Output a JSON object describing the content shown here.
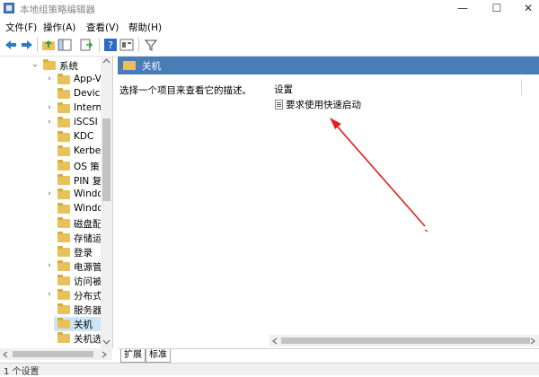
{
  "window": {
    "title": "本地组策略编辑器",
    "minimize": "—",
    "maximize": "☐",
    "close": "✕"
  },
  "menu": [
    "文件(F)",
    "操作(A)",
    "查看(V)",
    "帮助(H)"
  ],
  "tree": [
    {
      "label": "系统",
      "expander": "⌄",
      "indent": 1
    },
    {
      "label": "App-V",
      "expander": "›",
      "indent": 2
    },
    {
      "label": "Device",
      "expander": "",
      "indent": 2
    },
    {
      "label": "Intern",
      "expander": "›",
      "indent": 2
    },
    {
      "label": "iSCSI",
      "expander": "›",
      "indent": 2
    },
    {
      "label": "KDC",
      "expander": "",
      "indent": 2
    },
    {
      "label": "Kerbe",
      "expander": "",
      "indent": 2
    },
    {
      "label": "OS 策",
      "expander": "",
      "indent": 2
    },
    {
      "label": "PIN 复",
      "expander": "",
      "indent": 2
    },
    {
      "label": "Windo",
      "expander": "›",
      "indent": 2
    },
    {
      "label": "Windo",
      "expander": "",
      "indent": 2
    },
    {
      "label": "磁盘配",
      "expander": "",
      "indent": 2
    },
    {
      "label": "存储运",
      "expander": "",
      "indent": 2
    },
    {
      "label": "登录",
      "expander": "",
      "indent": 2
    },
    {
      "label": "电源管",
      "expander": "›",
      "indent": 2
    },
    {
      "label": "访问被",
      "expander": "",
      "indent": 2
    },
    {
      "label": "分布式",
      "expander": "›",
      "indent": 2
    },
    {
      "label": "服务器",
      "expander": "",
      "indent": 2
    },
    {
      "label": "关机",
      "expander": "",
      "indent": 2,
      "selected": true
    },
    {
      "label": "关机选",
      "expander": "",
      "indent": 2
    }
  ],
  "right": {
    "title": "关机",
    "description": "选择一个项目来查看它的描述。",
    "list_header": "设置",
    "settings": [
      "要求使用快速启动"
    ]
  },
  "tabs": [
    "扩展",
    "标准"
  ],
  "status": "1 个设置",
  "colors": {
    "header_blue": "#4a7cb6",
    "selection": "#cde6f7",
    "annotation_arrow": "#e02020"
  }
}
